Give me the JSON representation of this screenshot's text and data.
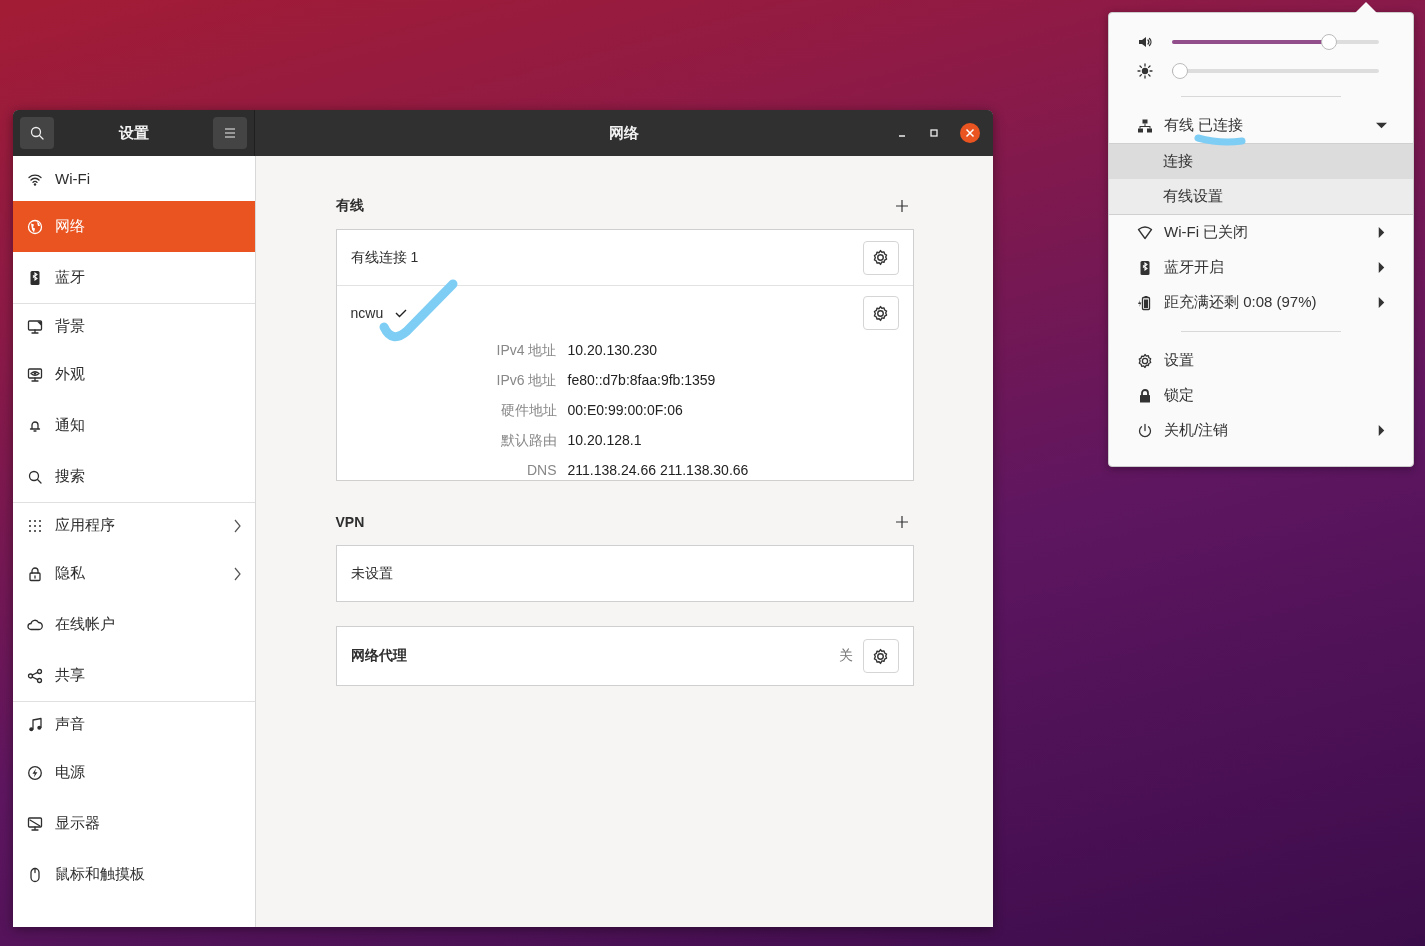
{
  "window": {
    "title": "网络",
    "sidebar_title": "设置"
  },
  "sidebar": {
    "groups": [
      {
        "items": [
          {
            "label": "Wi-Fi",
            "selected": false,
            "submenu": false
          },
          {
            "label": "网络",
            "selected": true,
            "submenu": false
          },
          {
            "label": "蓝牙",
            "selected": false,
            "submenu": false
          }
        ]
      },
      {
        "items": [
          {
            "label": "背景",
            "selected": false,
            "submenu": false
          },
          {
            "label": "外观",
            "selected": false,
            "submenu": false
          },
          {
            "label": "通知",
            "selected": false,
            "submenu": false
          },
          {
            "label": "搜索",
            "selected": false,
            "submenu": false
          }
        ]
      },
      {
        "items": [
          {
            "label": "应用程序",
            "selected": false,
            "submenu": true
          },
          {
            "label": "隐私",
            "selected": false,
            "submenu": true
          },
          {
            "label": "在线帐户",
            "selected": false,
            "submenu": false
          },
          {
            "label": "共享",
            "selected": false,
            "submenu": false
          }
        ]
      },
      {
        "items": [
          {
            "label": "声音",
            "selected": false,
            "submenu": false
          },
          {
            "label": "电源",
            "selected": false,
            "submenu": false
          },
          {
            "label": "显示器",
            "selected": false,
            "submenu": false
          },
          {
            "label": "鼠标和触摸板",
            "selected": false,
            "submenu": false
          }
        ]
      }
    ]
  },
  "wired": {
    "heading": "有线",
    "rows": [
      {
        "kind": "connection",
        "name": "有线连接 1"
      },
      {
        "kind": "details",
        "name": "ncwu",
        "active": true,
        "fields": [
          {
            "label": "IPv4 地址",
            "value": "10.20.130.230"
          },
          {
            "label": "IPv6 地址",
            "value": "fe80::d7b:8faa:9fb:1359"
          },
          {
            "label": "硬件地址",
            "value": "00:E0:99:00:0F:06"
          },
          {
            "label": "默认路由",
            "value": "10.20.128.1"
          },
          {
            "label": "DNS",
            "value": "211.138.24.66 211.138.30.66"
          }
        ]
      }
    ]
  },
  "vpn": {
    "heading": "VPN",
    "empty_text": "未设置"
  },
  "proxy": {
    "label": "网络代理",
    "status": "关"
  },
  "system_menu": {
    "sliders": [
      {
        "level": 0.76
      },
      {
        "level": 0.04
      }
    ],
    "network": {
      "label": "有线 已连接",
      "expanded": true,
      "items": [
        {
          "label": "连接",
          "selected": true
        },
        {
          "label": "有线设置",
          "selected": false
        }
      ]
    },
    "items": [
      {
        "label": "Wi-Fi 已关闭",
        "submenu": true
      },
      {
        "label": "蓝牙开启",
        "submenu": true
      },
      {
        "label": "距充满还剩 0:08 (97%)",
        "submenu": true
      }
    ],
    "actions": [
      {
        "label": "设置",
        "submenu": false
      },
      {
        "label": "锁定",
        "submenu": false
      },
      {
        "label": "关机/注销",
        "submenu": true
      }
    ]
  }
}
